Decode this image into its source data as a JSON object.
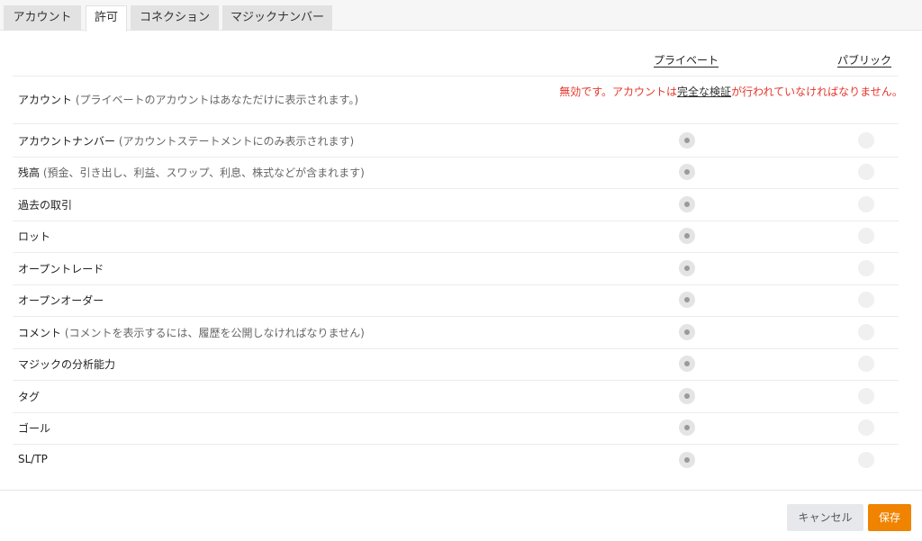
{
  "tabs": [
    "アカウント",
    "許可",
    "コネクション",
    "マジックナンバー"
  ],
  "columns": {
    "private": "プライベート",
    "public": "パブリック"
  },
  "account_row": {
    "label": "アカウント",
    "note": "(プライベートのアカウントはあなただけに表示されます。)",
    "warning_prefix": "無効です。アカウントは",
    "warning_link": "完全な検証",
    "warning_suffix": "が行われていなければなりません。"
  },
  "rows": [
    {
      "label": "アカウントナンバー",
      "note": "(アカウントステートメントにのみ表示されます)"
    },
    {
      "label": "残高",
      "note": "(預金、引き出し、利益、スワップ、利息、株式などが含まれます)"
    },
    {
      "label": "過去の取引",
      "note": ""
    },
    {
      "label": "ロット",
      "note": ""
    },
    {
      "label": "オープントレード",
      "note": ""
    },
    {
      "label": "オープンオーダー",
      "note": ""
    },
    {
      "label": "コメント",
      "note": "(コメントを表示するには、履歴を公開しなければなりません)"
    },
    {
      "label": "マジックの分析能力",
      "note": ""
    },
    {
      "label": "タグ",
      "note": ""
    },
    {
      "label": "ゴール",
      "note": ""
    },
    {
      "label": "SL/TP",
      "note": ""
    }
  ],
  "buttons": {
    "cancel": "キャンセル",
    "save": "保存"
  }
}
